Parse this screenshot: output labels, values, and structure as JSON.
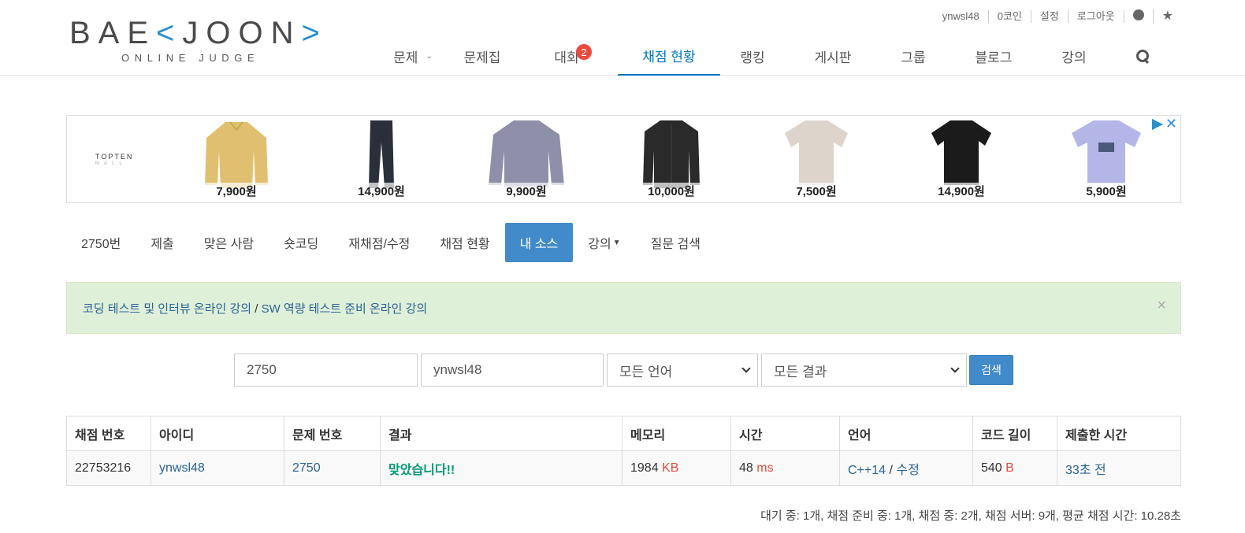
{
  "header": {
    "logo_left": "BAE",
    "logo_bracket_open": "<",
    "logo_right": "JOON",
    "logo_bracket_close": ">",
    "logo_sub": "ONLINE JUDGE",
    "top_links": [
      "ynwsl48",
      "0코인",
      "설정",
      "로그아웃"
    ],
    "nav": [
      {
        "label": "문제",
        "dropdown": true
      },
      {
        "label": "문제집"
      },
      {
        "label": "대회",
        "badge": "2"
      },
      {
        "label": "채점 현황",
        "active": true
      },
      {
        "label": "랭킹"
      },
      {
        "label": "게시판"
      },
      {
        "label": "그룹"
      },
      {
        "label": "블로그"
      },
      {
        "label": "강의"
      }
    ]
  },
  "ad": {
    "brand": "TOPTEN",
    "brand_sub": "MALL",
    "items": [
      {
        "price": "7,900원",
        "color": "#e0c070"
      },
      {
        "price": "14,900원",
        "color": "#2b2f3a"
      },
      {
        "price": "9,900원",
        "color": "#8e8fa8"
      },
      {
        "price": "10,000원",
        "color": "#2a2a2a"
      },
      {
        "price": "7,500원",
        "color": "#ddd4cc"
      },
      {
        "price": "14,900원",
        "color": "#1b1b1b"
      },
      {
        "price": "5,900원",
        "color": "#b3b6e6"
      }
    ]
  },
  "problem_menu": [
    {
      "label": "2750번"
    },
    {
      "label": "제출"
    },
    {
      "label": "맞은 사람"
    },
    {
      "label": "숏코딩"
    },
    {
      "label": "재채점/수정"
    },
    {
      "label": "채점 현황"
    },
    {
      "label": "내 소스",
      "active": true
    },
    {
      "label": "강의",
      "dropdown": true
    },
    {
      "label": "질문 검색"
    }
  ],
  "alert": {
    "link1": "코딩 테스트 및 인터뷰 온라인 강의",
    "separator": " / ",
    "link2": "SW 역량 테스트 준비 온라인 강의",
    "close": "×"
  },
  "search_form": {
    "problem_value": "2750",
    "user_value": "ynwsl48",
    "language_value": "모든 언어",
    "result_value": "모든 결과",
    "button": "검색"
  },
  "table": {
    "headers": [
      "채점 번호",
      "아이디",
      "문제 번호",
      "결과",
      "메모리",
      "시간",
      "언어",
      "코드 길이",
      "제출한 시간"
    ],
    "rows": [
      {
        "submission_id": "22753216",
        "user": "ynwsl48",
        "problem": "2750",
        "result": "맞았습니다!!",
        "memory": "1984",
        "memory_unit": "KB",
        "time": "48",
        "time_unit": "ms",
        "language": "C++14",
        "lang_sep": " / ",
        "edit": "수정",
        "code_length": "540",
        "code_unit": "B",
        "submitted": "33초 전"
      }
    ]
  },
  "footer_stats": "대기 중: 1개, 채점 준비 중: 1개, 채점 중: 2개, 채점 서버: 9개, 평균 채점 시간: 10.28초"
}
